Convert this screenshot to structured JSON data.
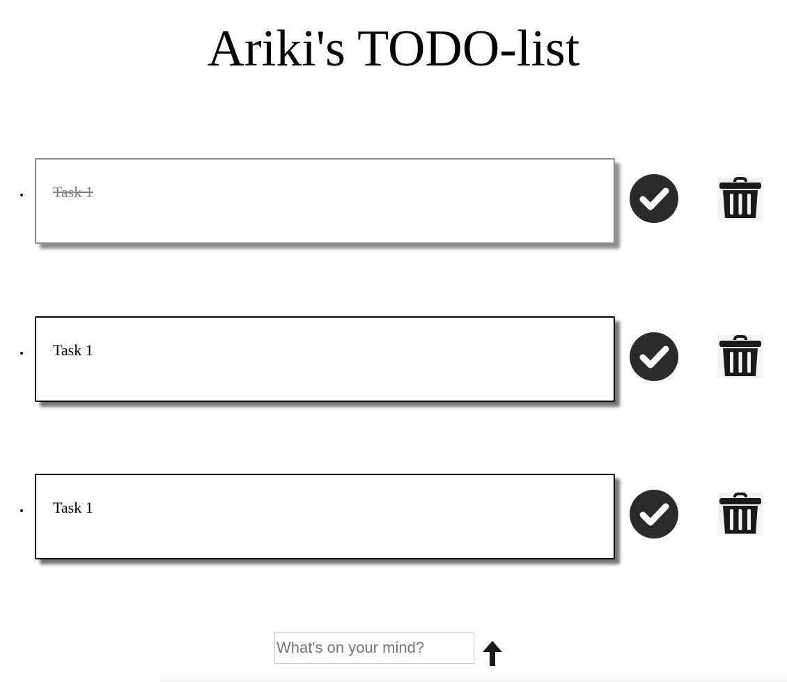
{
  "page": {
    "title": "Ariki's TODO-list"
  },
  "tasks": [
    {
      "text": "Task 1",
      "completed": true
    },
    {
      "text": "Task 1",
      "completed": false
    },
    {
      "text": "Task 1",
      "completed": false
    }
  ],
  "icons": {
    "complete": "check-circle-icon",
    "delete": "trash-icon",
    "submit": "arrow-up-icon"
  },
  "new_task": {
    "value": "",
    "placeholder": "What's on your mind?"
  },
  "colors": {
    "icon_dark": "#2b2b2b",
    "completed_text": "#7f7f7f",
    "completed_border": "#8a8a8a"
  }
}
